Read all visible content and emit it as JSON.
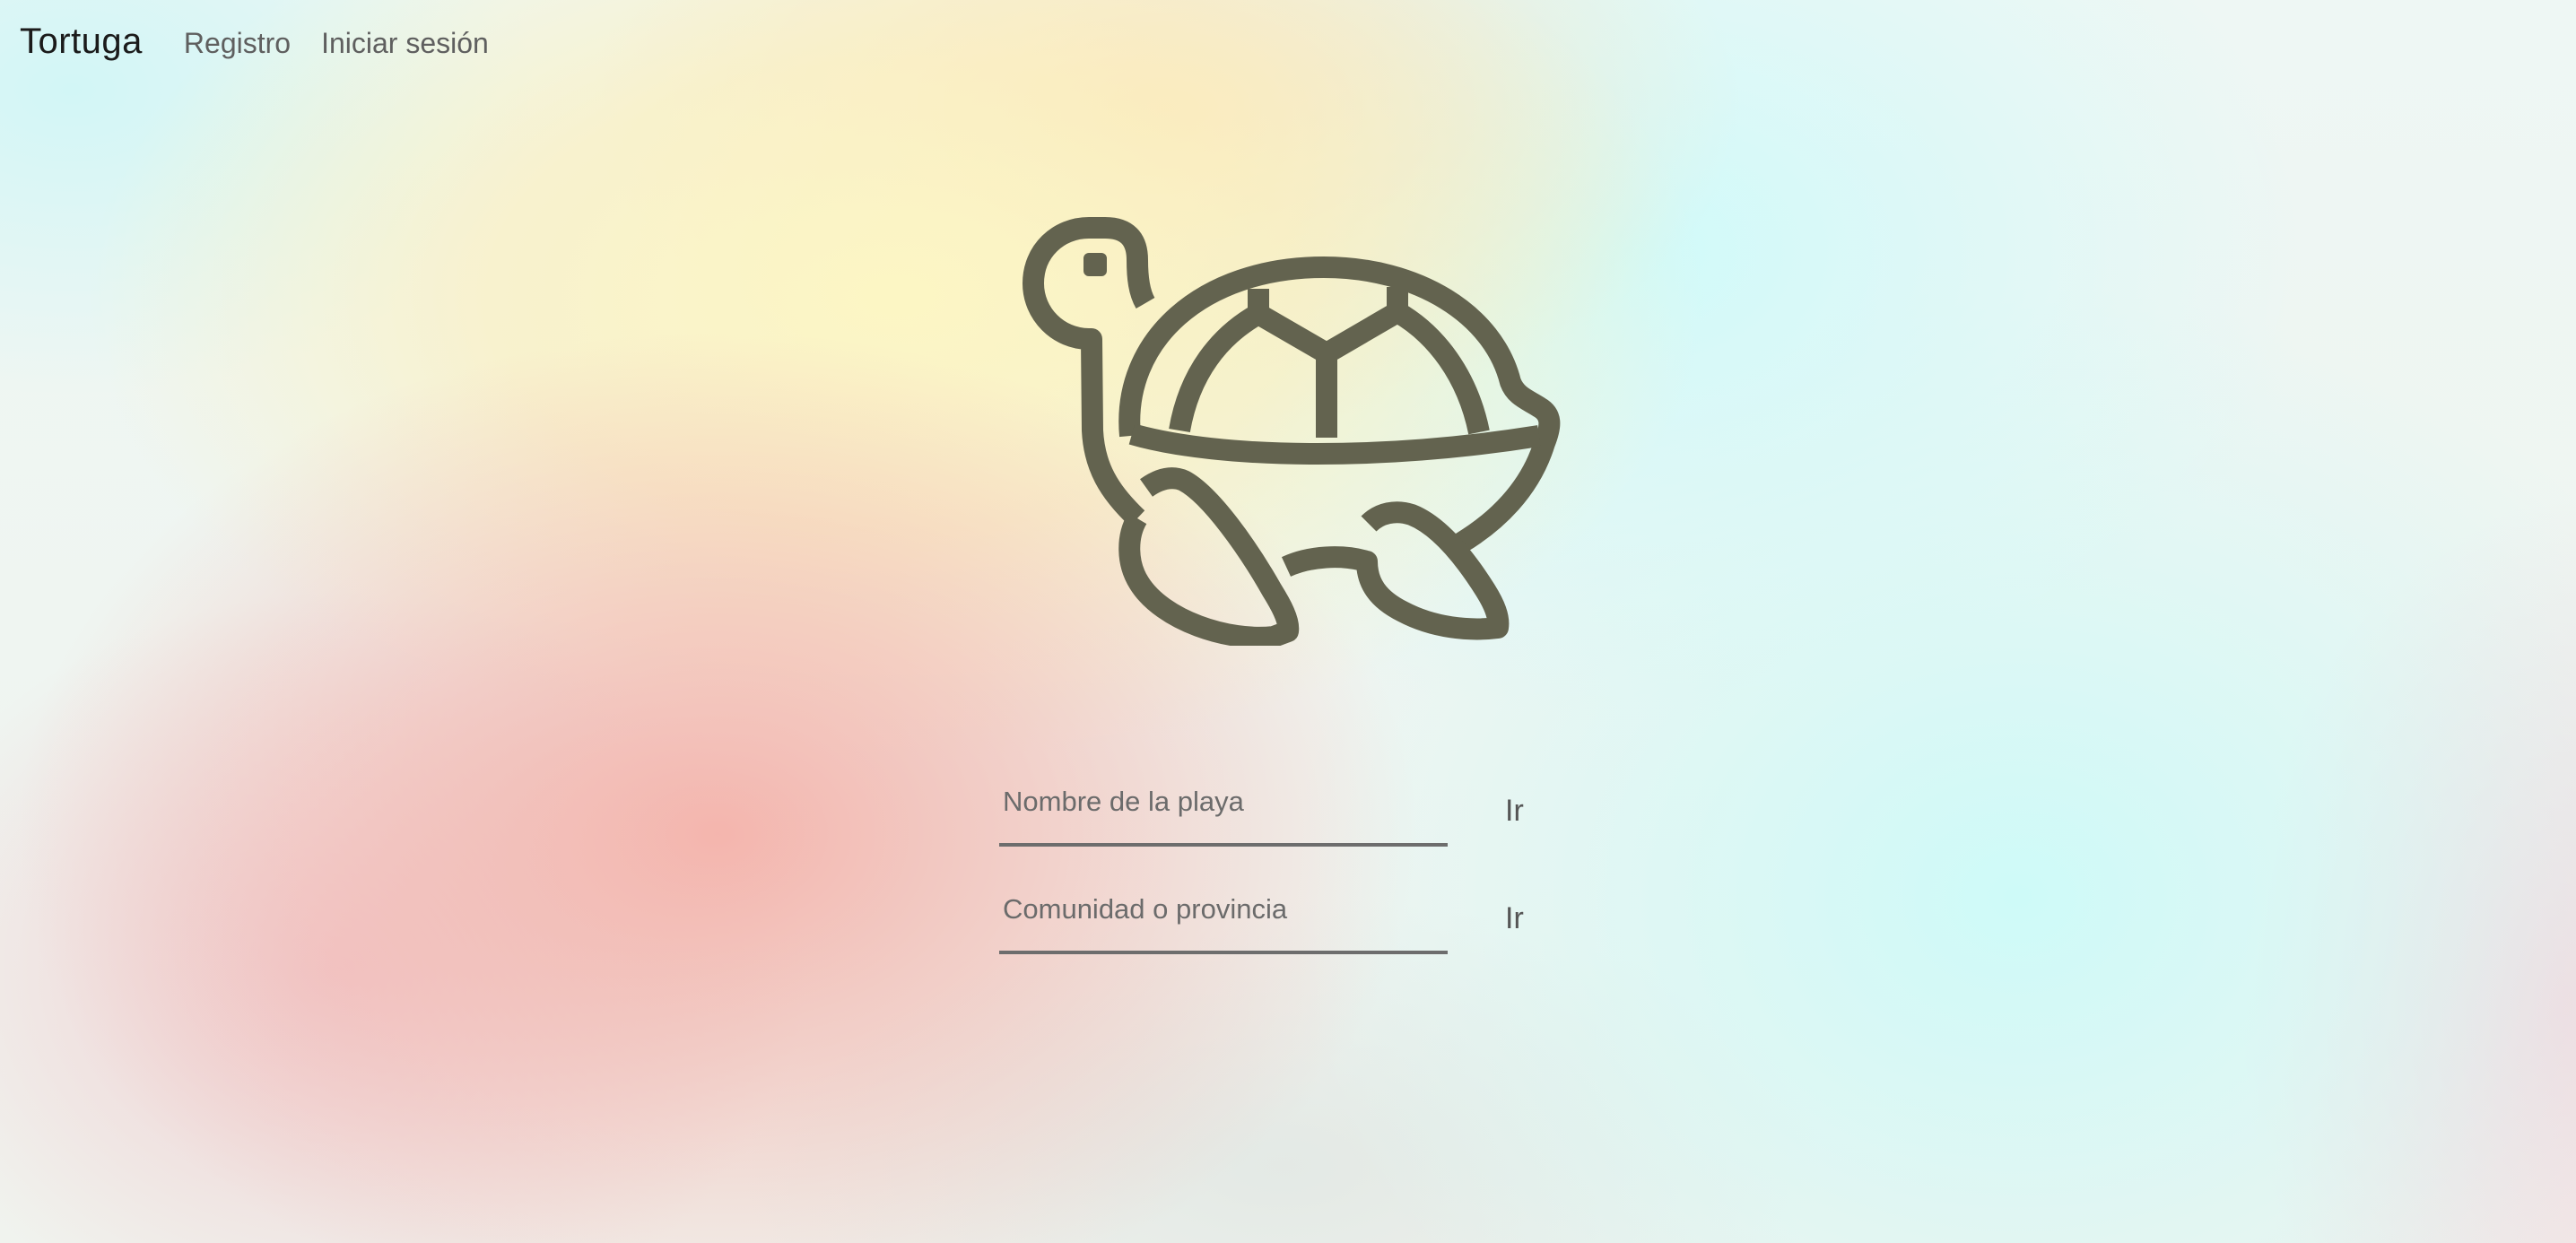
{
  "navbar": {
    "brand": "Tortuga",
    "links": [
      {
        "label": "Registro"
      },
      {
        "label": "Iniciar sesión"
      }
    ]
  },
  "logo": {
    "icon": "turtle-icon",
    "color": "#63634f"
  },
  "search_beach": {
    "placeholder": "Nombre de la playa",
    "button_label": "Ir"
  },
  "search_region": {
    "placeholder": "Comunidad o provincia",
    "button_label": "Ir"
  }
}
